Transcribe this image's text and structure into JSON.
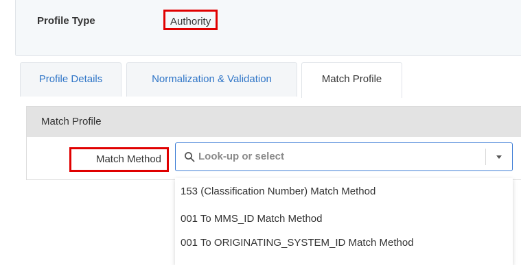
{
  "profile": {
    "type_label": "Profile Type",
    "type_value": "Authority"
  },
  "tabs": [
    {
      "label": "Profile Details",
      "active": false
    },
    {
      "label": "Normalization & Validation",
      "active": false
    },
    {
      "label": "Match Profile",
      "active": true
    }
  ],
  "match_section": {
    "header": "Match Profile",
    "method_label": "Match Method"
  },
  "select": {
    "placeholder": "Look-up or select",
    "icon": "search-icon",
    "options": [
      "153 (Classification Number) Match Method",
      "001 To MMS_ID Match Method",
      "001 To ORIGINATING_SYSTEM_ID Match Method"
    ]
  },
  "colors": {
    "highlight": "#e00000",
    "link": "#2f75c7",
    "focus_border": "#3a7bd5"
  }
}
